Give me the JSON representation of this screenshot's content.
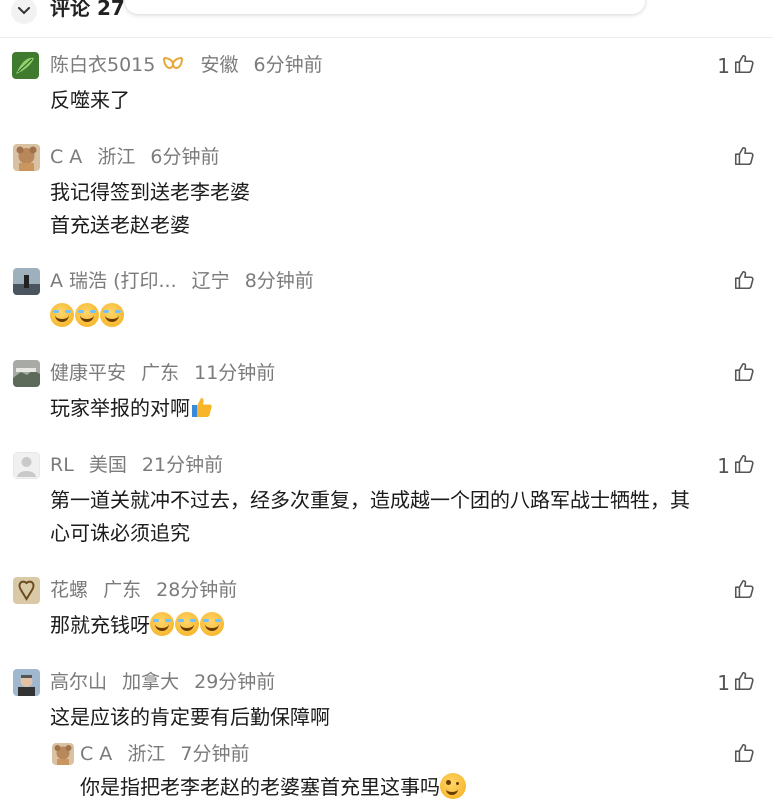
{
  "header": {
    "title": "评论 27"
  },
  "comments": [
    {
      "user": "陈白衣5015",
      "location": "安徽",
      "time": "6分钟前",
      "text": "反噬来了",
      "likes": "1"
    },
    {
      "user": "C A",
      "location": "浙江",
      "time": "6分钟前",
      "text_line1": "我记得签到送老李老婆",
      "text_line2": "首充送老赵老婆",
      "likes": ""
    },
    {
      "user": "A 瑞浩 (打印...",
      "location": "辽宁",
      "time": "8分钟前",
      "emoji": "laughing-crying-emoji x3",
      "likes": ""
    },
    {
      "user": "健康平安",
      "location": "广东",
      "time": "11分钟前",
      "text": "玩家举报的对啊",
      "emoji": "thumbs-up-emoji",
      "likes": ""
    },
    {
      "user": "RL",
      "location": "美国",
      "time": "21分钟前",
      "text_line1": "第一道关就冲不过去，经多次重复，造成越一个团的八路军战士牺牲，其",
      "text_line2": "心可诛必须追究",
      "likes": "1"
    },
    {
      "user": "花螺",
      "location": "广东",
      "time": "28分钟前",
      "text": "那就充钱呀",
      "emoji": "laughing-crying-emoji x3",
      "likes": ""
    },
    {
      "user": "高尔山",
      "location": "加拿大",
      "time": "29分钟前",
      "text": "这是应该的肯定要有后勤保障啊",
      "likes": "1"
    },
    {
      "user": "C A",
      "location": "浙江",
      "time": "7分钟前",
      "text": "你是指把老李老赵的老婆塞首充里这事吗",
      "emoji": "wink-emoji",
      "likes": ""
    }
  ],
  "icons": {
    "like": "thumbs-up-outline-icon",
    "collapse": "chevron-down-icon",
    "badge": "gold-badge-icon"
  },
  "colors": {
    "meta": "#7b7b7b",
    "text": "#1b1b1b",
    "badge": "#e7a83a"
  }
}
